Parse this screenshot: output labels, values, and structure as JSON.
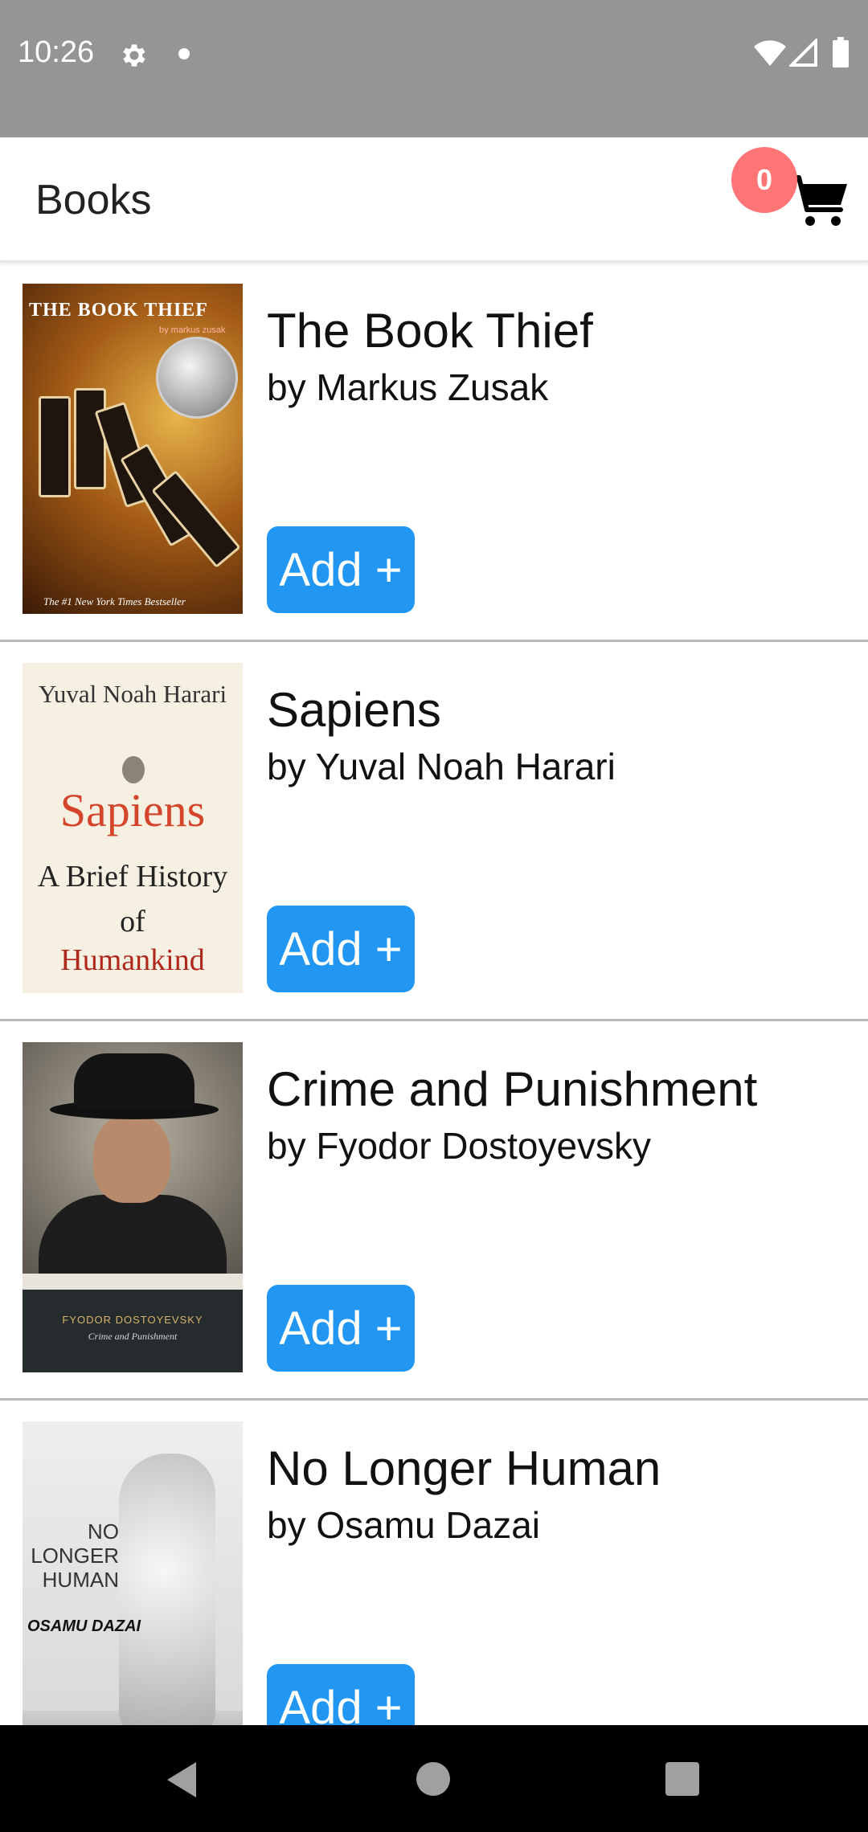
{
  "status_bar": {
    "time": "10:26",
    "icons": [
      "gear-icon",
      "notification-dot-icon",
      "wifi-icon",
      "signal-icon",
      "battery-icon"
    ]
  },
  "app_bar": {
    "title": "Books",
    "cart_count": "0",
    "cart_icon": "shopping-cart-icon",
    "badge_color": "#ff7474"
  },
  "books": [
    {
      "title": "The Book Thief",
      "author": "by Markus Zusak",
      "add_label": "Add +",
      "cover_text": {
        "title": "THE BOOK THIEF",
        "author": "by markus zusak",
        "tagline": "The #1 New York Times Bestseller"
      }
    },
    {
      "title": "Sapiens",
      "author": "by Yuval Noah Harari",
      "add_label": "Add +",
      "cover_text": {
        "author": "Yuval Noah Harari",
        "title": "Sapiens",
        "subtitle": "A Brief History of",
        "subtitle2": "Humankind"
      }
    },
    {
      "title": "Crime and Punishment",
      "author": "by Fyodor Dostoyevsky",
      "add_label": "Add +",
      "cover_text": {
        "author": "FYODOR DOSTOYEVSKY",
        "title": "Crime and Punishment"
      }
    },
    {
      "title": "No Longer Human",
      "author": "by Osamu Dazai",
      "add_label": "Add +",
      "cover_text": {
        "title": "NO LONGER HUMAN",
        "author": "OSAMU DAZAI"
      }
    }
  ],
  "colors": {
    "status_bar": "#959595",
    "add_button": "#2196f3",
    "nav_bar": "#000000"
  },
  "nav_bar": {
    "icons": [
      "back-icon",
      "home-icon",
      "recents-icon"
    ]
  }
}
